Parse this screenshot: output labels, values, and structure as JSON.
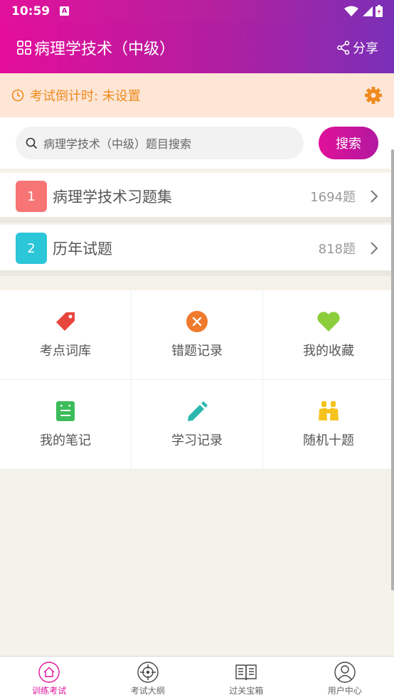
{
  "status_bar": {
    "time": "10:59",
    "badge": "A"
  },
  "app_bar": {
    "title": "病理学技术（中级）",
    "share_label": "分享"
  },
  "countdown": {
    "label": "考试倒计时: 未设置"
  },
  "search": {
    "placeholder": "病理学技术（中级）题目搜索",
    "button_label": "搜索"
  },
  "lists": [
    {
      "num": "1",
      "name": "病理学技术习题集",
      "count": "1694题",
      "color": "#f87575"
    },
    {
      "num": "2",
      "name": "历年试题",
      "count": "818题",
      "color": "#2bc6d7"
    }
  ],
  "grid": [
    {
      "label": "考点词库",
      "icon": "tag-icon",
      "color": "#e8453c"
    },
    {
      "label": "错题记录",
      "icon": "close-circle-icon",
      "color": "#f0792d"
    },
    {
      "label": "我的收藏",
      "icon": "heart-icon",
      "color": "#8ccd3c"
    },
    {
      "label": "我的笔记",
      "icon": "note-icon",
      "color": "#3cbc5a"
    },
    {
      "label": "学习记录",
      "icon": "pencil-icon",
      "color": "#2bb7ad"
    },
    {
      "label": "随机十题",
      "icon": "binoculars-icon",
      "color": "#f6c21e"
    }
  ],
  "bottom_nav": [
    {
      "label": "训练考试",
      "icon": "home-icon",
      "active": true
    },
    {
      "label": "考试大纲",
      "icon": "target-icon",
      "active": false
    },
    {
      "label": "过关宝箱",
      "icon": "book-icon",
      "active": false
    },
    {
      "label": "用户中心",
      "icon": "user-icon",
      "active": false
    }
  ],
  "colors": {
    "accent": "#e0119a",
    "countdown_text": "#ef8a1e",
    "countdown_bg": "#fde6d6"
  }
}
